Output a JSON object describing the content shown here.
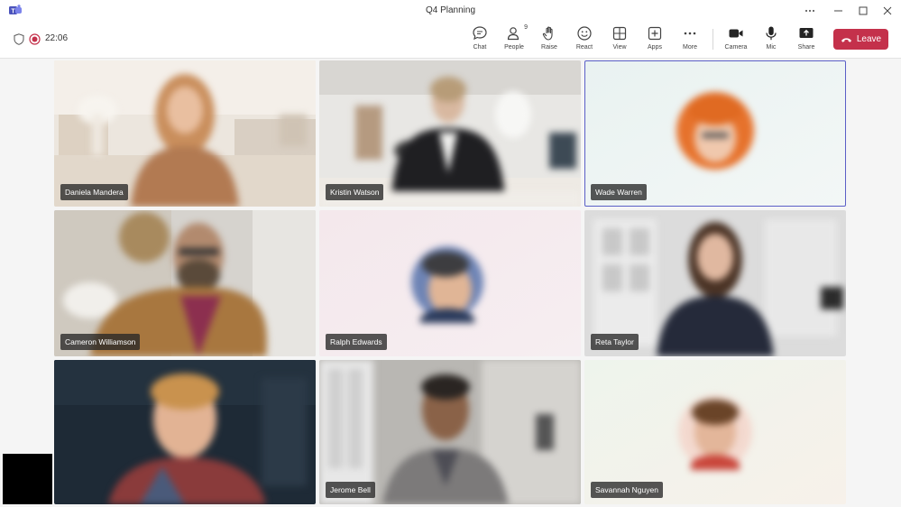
{
  "window": {
    "title": "Q4 Planning"
  },
  "meeting": {
    "timer": "22:06"
  },
  "toolbar": {
    "chat": "Chat",
    "people": "People",
    "people_count": "9",
    "raise": "Raise",
    "react": "React",
    "view": "View",
    "apps": "Apps",
    "more": "More",
    "camera": "Camera",
    "mic": "Mic",
    "share": "Share",
    "leave": "Leave"
  },
  "colors": {
    "leave": "#c4314b",
    "active_border": "#5b5fc7",
    "recording": "#c4314b"
  },
  "participants": [
    {
      "name": "Daniela Mandera",
      "type": "video"
    },
    {
      "name": "Kristin Watson",
      "type": "video"
    },
    {
      "name": "Wade Warren",
      "type": "avatar",
      "active": true
    },
    {
      "name": "Cameron Williamson",
      "type": "video"
    },
    {
      "name": "Ralph Edwards",
      "type": "avatar"
    },
    {
      "name": "Reta Taylor",
      "type": "video"
    },
    {
      "name": "Jerome Bell",
      "type": "video"
    },
    {
      "name": "Savannah Nguyen",
      "type": "avatar"
    }
  ]
}
